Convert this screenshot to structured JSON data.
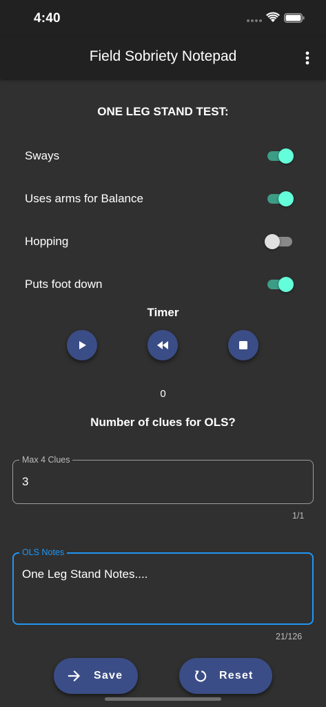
{
  "status_bar": {
    "time": "4:40"
  },
  "app_bar": {
    "title": "Field Sobriety Notepad"
  },
  "test": {
    "title": "ONE LEG STAND TEST:",
    "toggles": [
      {
        "label": "Sways",
        "on": true
      },
      {
        "label": "Uses arms for Balance",
        "on": true
      },
      {
        "label": "Hopping",
        "on": false
      },
      {
        "label": "Puts foot down",
        "on": true
      }
    ]
  },
  "timer": {
    "title": "Timer",
    "value": "0"
  },
  "clues": {
    "question": "Number of clues for OLS?",
    "field_label": "Max 4 Clues",
    "field_value": "3",
    "counter": "1/1"
  },
  "notes": {
    "field_label": "OLS Notes",
    "field_value": "One Leg Stand Notes....",
    "counter": "21/126"
  },
  "actions": {
    "save_label": "Save",
    "reset_label": "Reset"
  },
  "colors": {
    "background": "#303030",
    "app_bar": "#212121",
    "accent": "#64ffda",
    "button": "#3b4d86",
    "focus": "#2196f3"
  },
  "icons": {
    "more": "more-vert-icon",
    "play": "play-icon",
    "rewind": "rewind-icon",
    "stop": "stop-icon",
    "save": "arrow-forward-icon",
    "reset": "refresh-icon"
  }
}
